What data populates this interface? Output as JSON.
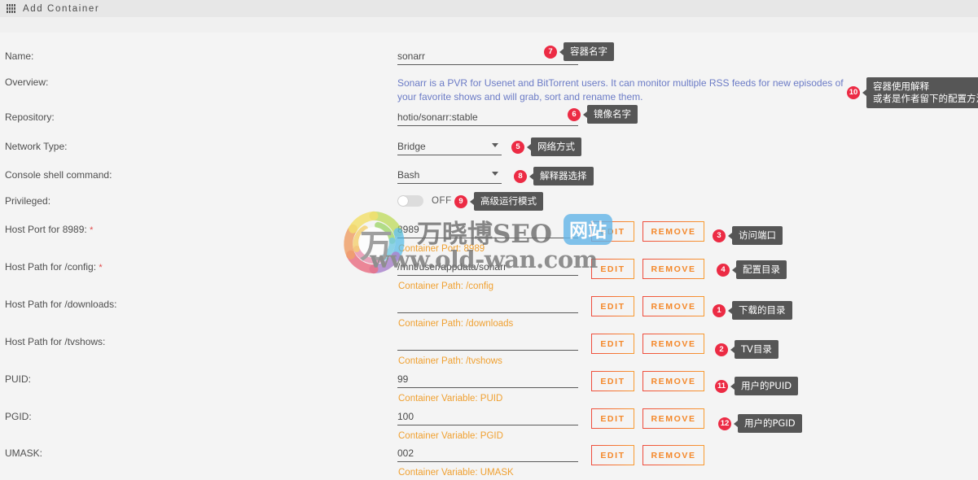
{
  "titlebar": {
    "icon": "grid-apps-icon",
    "title": "Add Container"
  },
  "form": {
    "rows": [
      {
        "label": "Name:",
        "required": false,
        "value": "sonarr",
        "hint": null,
        "control": "text"
      },
      {
        "label": "Overview:",
        "required": false,
        "value": "Sonarr is a PVR for Usenet and BitTorrent users. It can monitor multiple RSS feeds for new episodes of your favorite shows and will grab, sort and rename them.",
        "hint": null,
        "control": "paragraph"
      },
      {
        "label": "Repository:",
        "required": false,
        "value": "hotio/sonarr:stable",
        "hint": null,
        "control": "text"
      },
      {
        "label": "Network Type:",
        "required": false,
        "value": "Bridge",
        "hint": null,
        "control": "select"
      },
      {
        "label": "Console shell command:",
        "required": false,
        "value": "Bash",
        "hint": null,
        "control": "select"
      },
      {
        "label": "Privileged:",
        "required": false,
        "value": "OFF",
        "hint": null,
        "control": "toggle"
      },
      {
        "label": "Host Port for 8989:",
        "required": true,
        "value": "8989",
        "hint": "Container Port: 8989",
        "control": "text-with-actions"
      },
      {
        "label": "Host Path for /config:",
        "required": true,
        "value": "/mnt/user/appdata/sonarr",
        "hint": "Container Path: /config",
        "control": "text-with-actions"
      },
      {
        "label": "Host Path for /downloads:",
        "required": false,
        "value": "",
        "hint": "Container Path: /downloads",
        "control": "text-with-actions"
      },
      {
        "label": "Host Path for /tvshows:",
        "required": false,
        "value": "",
        "hint": "Container Path: /tvshows",
        "control": "text-with-actions"
      },
      {
        "label": "PUID:",
        "required": false,
        "value": "99",
        "hint": "Container Variable: PUID",
        "control": "text-with-actions"
      },
      {
        "label": "PGID:",
        "required": false,
        "value": "100",
        "hint": "Container Variable: PGID",
        "control": "text-with-actions"
      },
      {
        "label": "UMASK:",
        "required": false,
        "value": "002",
        "hint": "Container Variable: UMASK",
        "control": "text-with-actions"
      }
    ],
    "buttons": {
      "edit": "EDIT",
      "remove": "REMOVE"
    }
  },
  "annotations": [
    {
      "number": "7",
      "text": "容器名字"
    },
    {
      "number": "10",
      "text": "容器使用解释\n或者是作者留下的配置方法"
    },
    {
      "number": "6",
      "text": "镜像名字"
    },
    {
      "number": "5",
      "text": "网络方式"
    },
    {
      "number": "8",
      "text": "解释器选择"
    },
    {
      "number": "9",
      "text": "高级运行模式"
    },
    {
      "number": "3",
      "text": "访问端口"
    },
    {
      "number": "4",
      "text": "配置目录"
    },
    {
      "number": "1",
      "text": "下载的目录"
    },
    {
      "number": "2",
      "text": "TV目录"
    },
    {
      "number": "11",
      "text": "用户的PUID"
    },
    {
      "number": "12",
      "text": "用户的PGID"
    }
  ],
  "watermark": {
    "glyph": "万",
    "title": "万晓博SEO",
    "badge": "网站",
    "url": "www.old-wan.com"
  },
  "colors": {
    "accent_orange": "#f4882a",
    "badge_red": "#ec2b44",
    "tooltip_gray": "#565656",
    "overview_blue": "#6b7bc6",
    "hint_orange": "#f0a030"
  }
}
